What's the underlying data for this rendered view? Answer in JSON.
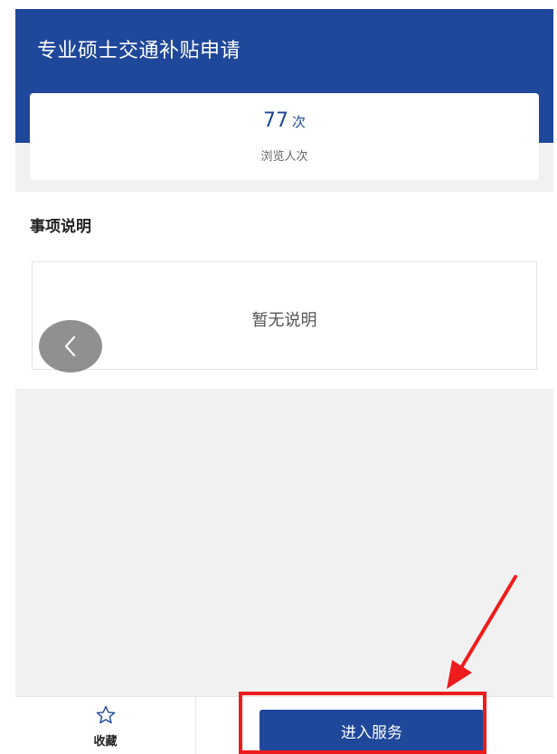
{
  "header": {
    "title": "专业硕士交通补贴申请"
  },
  "stats": {
    "value": "77",
    "unit": "次",
    "label": "浏览人次"
  },
  "section": {
    "title": "事项说明",
    "content": "暂无说明"
  },
  "back": {
    "icon": "chevron-left-icon"
  },
  "bottom_bar": {
    "favorite_label": "收藏",
    "favorite_icon": "star-outline-icon",
    "enter_button_label": "进入服务"
  },
  "annotation": {
    "color": "#ee1c1c",
    "target": "enter-service-button"
  },
  "colors": {
    "brand": "#1f479a",
    "background": "#f1f1f1"
  }
}
